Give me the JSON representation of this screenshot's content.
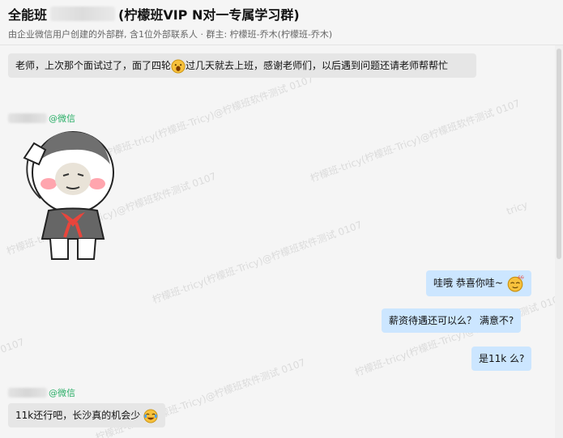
{
  "header": {
    "title_prefix": "全能班",
    "title_suffix": "(柠檬班VIP N对一专属学习群)",
    "subtitle": "由企业微信用户创建的外部群, 含1位外部联系人 · 群主: 柠檬班-乔木(柠檬班-乔木)"
  },
  "messages": [
    {
      "side": "left",
      "text": "老师，上次那个面试过了，面了四轮",
      "emoji": "grin-emoji",
      "text2": "过几天就去上班，感谢老师们，以后遇到问题还请老师帮帮忙"
    },
    {
      "side": "left",
      "sender_suffix": "@微信",
      "sticker": "salute-sticker"
    },
    {
      "side": "right",
      "text": "哇哦 恭喜你哇~",
      "emoji": "clap-emoji"
    },
    {
      "side": "right",
      "text": "薪资待遇还可以么？  满意不?"
    },
    {
      "side": "right",
      "text": "是11k 么?"
    },
    {
      "side": "left",
      "sender_suffix": "@微信",
      "text": "11k还行吧，长沙真的机会少",
      "emoji": "laugh-cry-emoji"
    }
  ],
  "watermark": {
    "text": "柠檬班-tricy(柠檬班-Tricy)@柠檬班软件测试 0107",
    "short": "tricy",
    "suffix": "0107"
  },
  "colors": {
    "accent_green": "#2aae67",
    "right_bubble": "#cce6ff",
    "left_bubble": "#e6e6e6"
  }
}
